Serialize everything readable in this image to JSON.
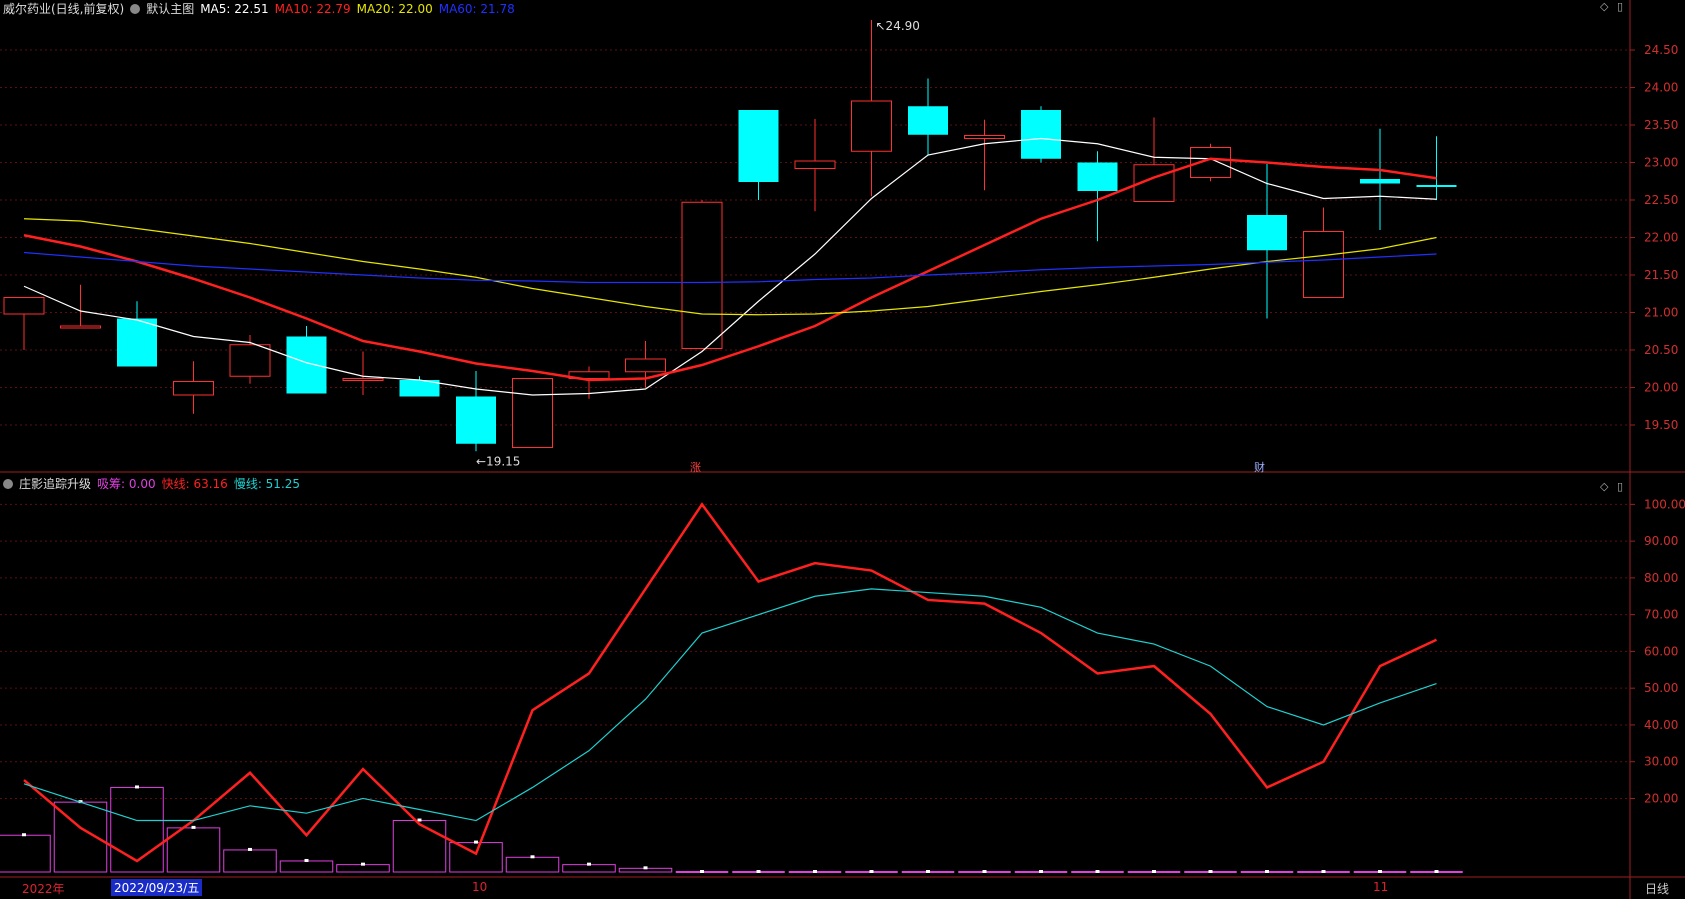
{
  "header": {
    "stock": "威尔药业(日线,前复权)",
    "main_name": "默认主图",
    "ma": [
      {
        "label": "MA5: 22.51",
        "color": "#ffffff"
      },
      {
        "label": "MA10: 22.79",
        "color": "#ff2020"
      },
      {
        "label": "MA20: 22.00",
        "color": "#e6e600"
      },
      {
        "label": "MA60: 21.78",
        "color": "#2030ff"
      }
    ]
  },
  "sub_header": {
    "name": "庄影追踪升级",
    "items": [
      {
        "label": "吸筹: 0.00",
        "color": "#e040e0"
      },
      {
        "label": "快线: 63.16",
        "color": "#ff2020"
      },
      {
        "label": "慢线: 51.25",
        "color": "#20d0d0"
      }
    ]
  },
  "markers": {
    "zhang": "涨",
    "cai": "财",
    "high_label": "24.90",
    "low_label": "19.15"
  },
  "xaxis": {
    "year": "2022年",
    "date": "2022/09/23/五",
    "oct": "10",
    "nov": "11",
    "timeframe": "日线"
  },
  "chart_data": [
    {
      "type": "candlestick",
      "title": "威尔药业(日线,前复权)",
      "ylim": [
        19.1,
        24.9
      ],
      "yticks": [
        19.5,
        20.0,
        20.5,
        21.0,
        21.5,
        22.0,
        22.5,
        23.0,
        23.5,
        24.0,
        24.5
      ],
      "candles": [
        {
          "o": 21.2,
          "h": 21.2,
          "l": 20.5,
          "c": 20.98,
          "up": true
        },
        {
          "o": 20.8,
          "h": 21.37,
          "l": 20.8,
          "c": 20.82,
          "up": true
        },
        {
          "o": 20.92,
          "h": 21.15,
          "l": 20.28,
          "c": 20.28,
          "up": false
        },
        {
          "o": 19.9,
          "h": 20.35,
          "l": 19.65,
          "c": 20.08,
          "up": true
        },
        {
          "o": 20.15,
          "h": 20.7,
          "l": 20.05,
          "c": 20.57,
          "up": true
        },
        {
          "o": 20.68,
          "h": 20.82,
          "l": 19.92,
          "c": 19.92,
          "up": false
        },
        {
          "o": 20.1,
          "h": 20.48,
          "l": 19.9,
          "c": 20.12,
          "up": true
        },
        {
          "o": 20.1,
          "h": 20.15,
          "l": 19.88,
          "c": 19.88,
          "up": false
        },
        {
          "o": 19.88,
          "h": 20.22,
          "l": 19.15,
          "c": 19.25,
          "up": false
        },
        {
          "o": 19.2,
          "h": 20.12,
          "l": 19.2,
          "c": 20.12,
          "up": true
        },
        {
          "o": 20.12,
          "h": 20.28,
          "l": 19.85,
          "c": 20.21,
          "up": true
        },
        {
          "o": 20.21,
          "h": 20.62,
          "l": 20.0,
          "c": 20.38,
          "up": true
        },
        {
          "o": 20.52,
          "h": 22.5,
          "l": 20.52,
          "c": 22.47,
          "up": true
        },
        {
          "o": 23.7,
          "h": 23.7,
          "l": 22.5,
          "c": 22.74,
          "up": false
        },
        {
          "o": 22.92,
          "h": 23.58,
          "l": 22.35,
          "c": 23.02,
          "up": true
        },
        {
          "o": 23.15,
          "h": 24.9,
          "l": 22.55,
          "c": 23.82,
          "up": true
        },
        {
          "o": 23.75,
          "h": 24.12,
          "l": 23.1,
          "c": 23.37,
          "up": false
        },
        {
          "o": 23.32,
          "h": 23.57,
          "l": 22.63,
          "c": 23.36,
          "up": true
        },
        {
          "o": 23.7,
          "h": 23.75,
          "l": 23.0,
          "c": 23.05,
          "up": false
        },
        {
          "o": 23.0,
          "h": 23.15,
          "l": 21.95,
          "c": 22.62,
          "up": false
        },
        {
          "o": 22.48,
          "h": 23.6,
          "l": 22.48,
          "c": 22.97,
          "up": true
        },
        {
          "o": 22.8,
          "h": 23.25,
          "l": 22.75,
          "c": 23.2,
          "up": true
        },
        {
          "o": 22.3,
          "h": 22.98,
          "l": 20.92,
          "c": 21.83,
          "up": false
        },
        {
          "o": 21.2,
          "h": 22.4,
          "l": 21.2,
          "c": 22.08,
          "up": true
        },
        {
          "o": 22.78,
          "h": 23.45,
          "l": 22.1,
          "c": 22.72,
          "up": false
        },
        {
          "o": 22.7,
          "h": 23.35,
          "l": 22.5,
          "c": 22.7,
          "up": false
        }
      ],
      "series": [
        {
          "name": "MA5",
          "color": "#ffffff",
          "values": [
            21.35,
            21.02,
            20.9,
            20.68,
            20.6,
            20.33,
            20.15,
            20.1,
            19.98,
            19.9,
            19.92,
            19.98,
            20.48,
            21.15,
            21.78,
            22.52,
            23.1,
            23.25,
            23.32,
            23.25,
            23.07,
            23.05,
            22.72,
            22.52,
            22.55,
            22.51
          ]
        },
        {
          "name": "MA10",
          "color": "#ff2020",
          "values": [
            22.03,
            21.88,
            21.68,
            21.45,
            21.2,
            20.92,
            20.62,
            20.48,
            20.32,
            20.22,
            20.1,
            20.12,
            20.3,
            20.55,
            20.82,
            21.2,
            21.55,
            21.9,
            22.25,
            22.5,
            22.8,
            23.05,
            23.0,
            22.94,
            22.9,
            22.79
          ]
        },
        {
          "name": "MA20",
          "color": "#e6e600",
          "values": [
            22.25,
            22.22,
            22.12,
            22.02,
            21.92,
            21.8,
            21.68,
            21.58,
            21.47,
            21.32,
            21.2,
            21.08,
            20.98,
            20.97,
            20.98,
            21.02,
            21.08,
            21.18,
            21.28,
            21.37,
            21.47,
            21.58,
            21.68,
            21.76,
            21.85,
            22.0
          ]
        },
        {
          "name": "MA60",
          "color": "#2030ff",
          "values": [
            21.8,
            21.74,
            21.68,
            21.62,
            21.58,
            21.54,
            21.5,
            21.46,
            21.43,
            21.42,
            21.4,
            21.4,
            21.4,
            21.41,
            21.44,
            21.46,
            21.5,
            21.53,
            21.57,
            21.6,
            21.62,
            21.64,
            21.67,
            21.7,
            21.74,
            21.78
          ]
        }
      ]
    },
    {
      "type": "line",
      "title": "庄影追踪升级",
      "ylim": [
        0,
        102
      ],
      "yticks": [
        20,
        30,
        40,
        50,
        60,
        70,
        80,
        90,
        100
      ],
      "series": [
        {
          "name": "快线",
          "color": "#ff2020",
          "values": [
            25,
            12,
            3,
            14,
            27,
            10,
            28,
            13,
            5,
            44,
            54,
            77,
            100,
            79,
            84,
            82,
            74,
            73,
            65,
            54,
            56,
            43,
            23,
            30,
            56,
            63.16
          ]
        },
        {
          "name": "慢线",
          "color": "#20d0d0",
          "values": [
            24,
            19,
            14,
            14,
            18,
            16,
            20,
            17,
            14,
            23,
            33,
            47,
            65,
            70,
            75,
            77,
            76,
            75,
            72,
            65,
            62,
            56,
            45,
            40,
            46,
            51.25
          ]
        }
      ],
      "bars": [
        {
          "name": "吸筹",
          "color": "#e040e0",
          "values": [
            10,
            19,
            23,
            12,
            6,
            3,
            2,
            14,
            8,
            4,
            2,
            1,
            0,
            0,
            0,
            0,
            0,
            0,
            0,
            0,
            0,
            0,
            0,
            0,
            0,
            0
          ]
        }
      ]
    }
  ]
}
